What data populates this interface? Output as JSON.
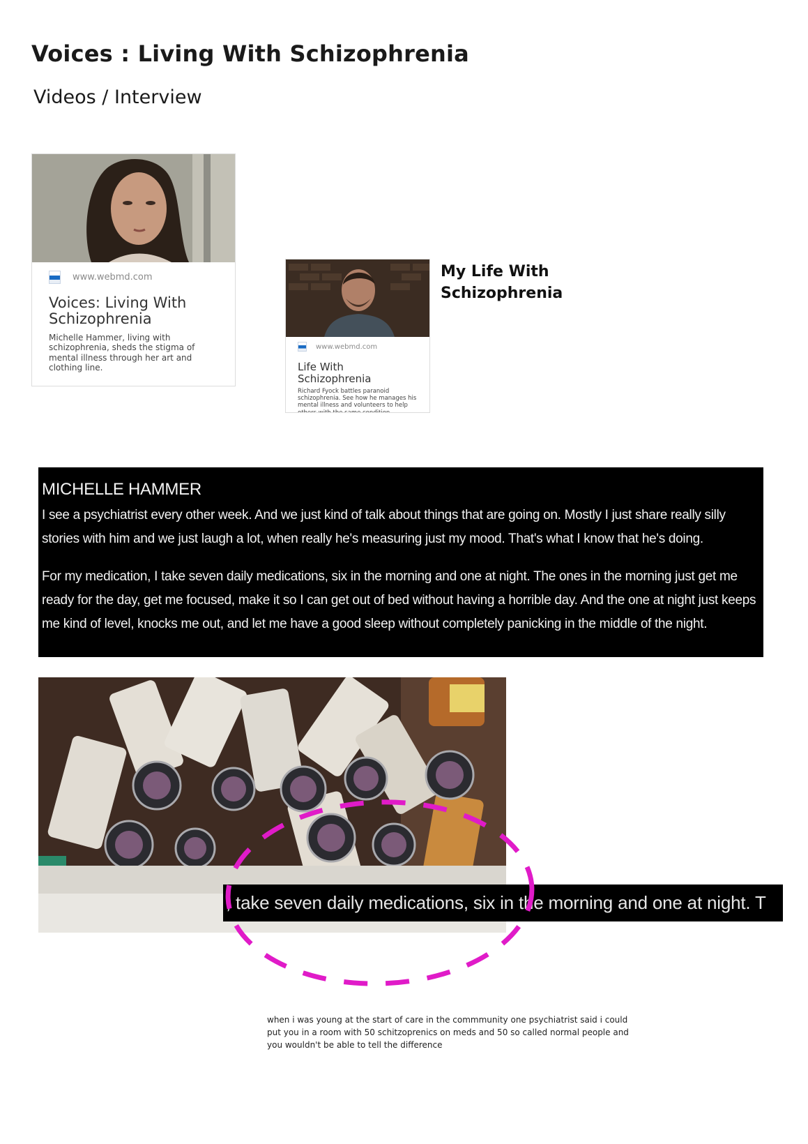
{
  "page": {
    "title": "Voices : Living With Schizophrenia",
    "subtitle": "Videos / Interview"
  },
  "cards": [
    {
      "source": "www.webmd.com",
      "title": "Voices: Living With Schizophrenia",
      "description": "Michelle Hammer, living with schizophrenia, sheds the stigma of mental illness through her art and clothing line."
    },
    {
      "source": "www.webmd.com",
      "title": "Life With Schizophrenia",
      "description": "Richard Fyock battles paranoid schizophrenia. See how he manages his mental illness and volunteers to help others with the same condition."
    }
  ],
  "side_title": {
    "line1": "My Life With",
    "line2": "Schizophrenia"
  },
  "transcript": {
    "speaker": "MICHELLE HAMMER",
    "paragraph1": "I see a psychiatrist every other week. And we just kind of talk about things that are going on. Mostly I just share really silly stories with him and we just laugh a lot, when really he's measuring just my mood. That's what I know that he's doing.",
    "paragraph2": "For my medication, I take seven daily medications, six in the morning and one at night. The ones in the morning just get me ready for the day, get me focused, make it so I can get out of bed without having a horrible day. And the one at night just keeps me kind of level, knocks me out, and let me have a good sleep without completely panicking in the middle of the night."
  },
  "video_caption": ", take seven daily medications, six in the morning and one at night. T",
  "annotation_color": "#e01bc8",
  "quote": "when i was young at the start of care in the commmunity one psychiatrist said i could put you in a room with 50 schitzoprenics on meds and 50 so called normal people and you wouldn't be able to tell the difference"
}
